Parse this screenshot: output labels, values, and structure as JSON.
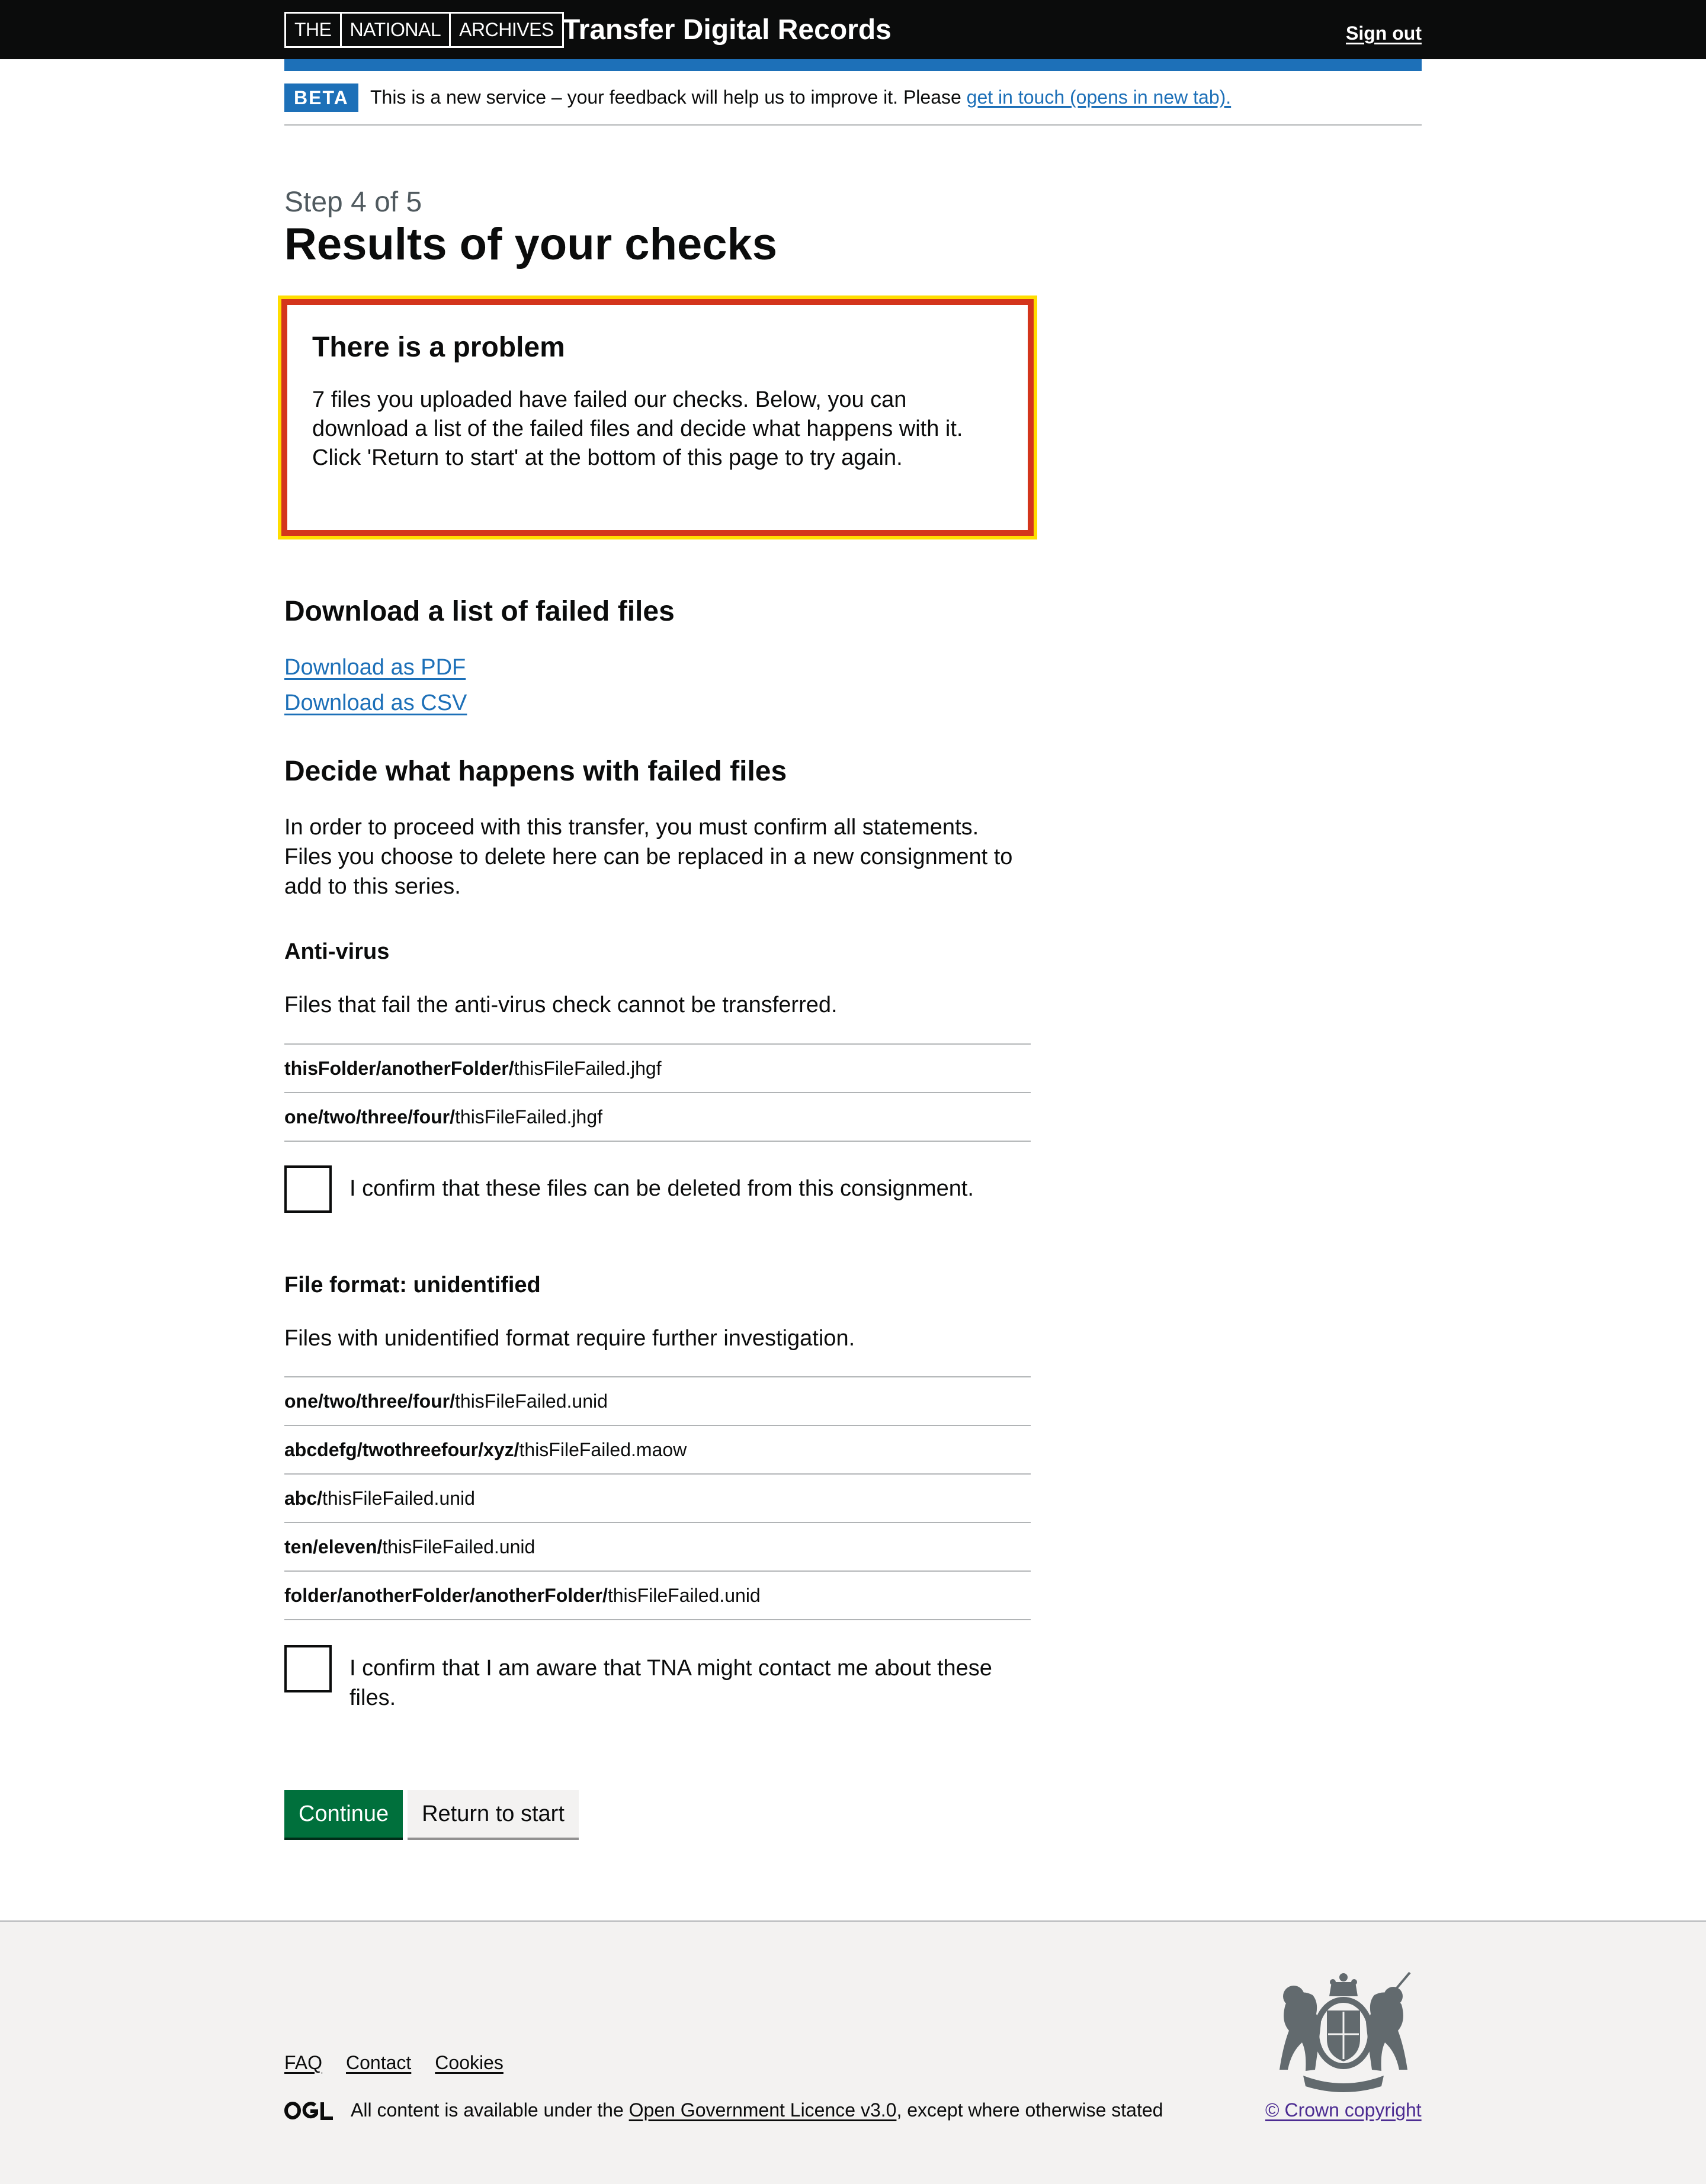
{
  "header": {
    "logo_parts": [
      "THE",
      "NATIONAL",
      "ARCHIVES"
    ],
    "service_name": "Transfer Digital Records",
    "sign_out": "Sign out"
  },
  "phase_banner": {
    "tag": "BETA",
    "text": "This is a new service – your feedback will help us to improve it. Please ",
    "link": "get in touch (opens in new tab)."
  },
  "page": {
    "caption": "Step 4 of 5",
    "title": "Results of your checks"
  },
  "error_summary": {
    "title": "There is a problem",
    "lines": [
      "7 files you uploaded have failed our checks. Below, you can",
      "download a list of the failed files and decide what happens with it.",
      "Click 'Return to start' at the bottom of this page to try again."
    ]
  },
  "download_section": {
    "heading": "Download a list of failed files",
    "pdf_link": "Download as PDF",
    "csv_link": "Download as CSV"
  },
  "decide_section": {
    "heading": "Decide what happens with failed files",
    "intro_lines": [
      "In order to proceed with this transfer, you must confirm all statements.",
      "Files you choose to delete here can be replaced in a new consignment to",
      "add to this series."
    ]
  },
  "antivirus": {
    "heading": "Anti-virus",
    "description": "Files that fail the anti-virus check cannot be transferred.",
    "files": [
      {
        "path": "thisFolder/anotherFolder/",
        "name": "thisFileFailed.jhgf"
      },
      {
        "path": "one/two/three/four/",
        "name": "thisFileFailed.jhgf"
      }
    ],
    "confirm_label": "I confirm that these files can be deleted from this consignment."
  },
  "file_format": {
    "heading": "File format: unidentified",
    "description": "Files with unidentified format require further investigation.",
    "files": [
      {
        "path": "one/two/three/four/",
        "name": "thisFileFailed.unid"
      },
      {
        "path": "abcdefg/twothreefour/xyz/",
        "name": "thisFileFailed.maow"
      },
      {
        "path": "abc/",
        "name": "thisFileFailed.unid"
      },
      {
        "path": "ten/eleven/",
        "name": "thisFileFailed.unid"
      },
      {
        "path": "folder/anotherFolder/anotherFolder/",
        "name": "thisFileFailed.unid"
      }
    ],
    "confirm_label": "I confirm that I am aware that TNA might contact me about these files."
  },
  "buttons": {
    "continue": "Continue",
    "return": "Return to start"
  },
  "footer": {
    "links": [
      "FAQ",
      "Contact",
      "Cookies"
    ],
    "licence_prefix": "All content is available under the ",
    "licence_link": "Open Government Licence v3.0",
    "licence_suffix": ", except where otherwise stated",
    "copyright": "© Crown copyright"
  }
}
